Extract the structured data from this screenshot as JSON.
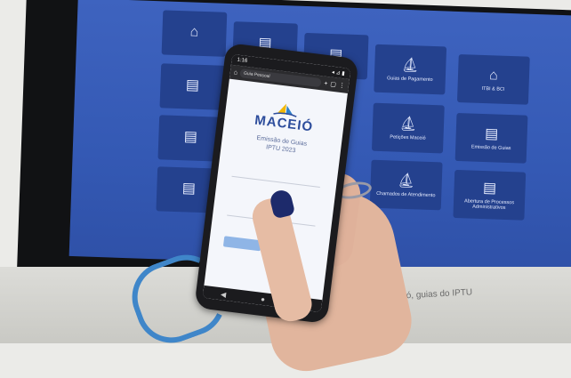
{
  "scene": {
    "description_colors": {
      "screen": "#3a5fbd",
      "tile": "#24418e",
      "phone": "#1b1b1e",
      "cable": "#3f86c9"
    }
  },
  "monitor": {
    "tiles": [
      {
        "label": "",
        "icon": "house-icon"
      },
      {
        "label": "",
        "icon": "document-icon"
      },
      {
        "label": "",
        "icon": "document-icon"
      },
      {
        "label": "Guias de Pagamento",
        "icon": "sail-icon"
      },
      {
        "label": "ITBI & BCI",
        "icon": "building-icon"
      },
      {
        "label": "",
        "icon": "document-icon"
      },
      {
        "label": "",
        "icon": "document-icon"
      },
      {
        "label": "Petições Maceió",
        "icon": "sail-icon"
      },
      {
        "label": "Emissão de Guias",
        "icon": "document-icon"
      },
      {
        "label": "",
        "icon": "document-icon"
      },
      {
        "label": "Chamados de Atendimento",
        "icon": "sail-icon"
      },
      {
        "label": "Abertura de Processos Administrativos",
        "icon": "document-icon"
      },
      {
        "label": "",
        "icon": "document-icon"
      }
    ],
    "bottom_text": "Maceió, guias do IPTU"
  },
  "phone": {
    "status_time": "1:16",
    "status_icons": "◂ ⊿ ▮",
    "url": "Guia Pessoal",
    "logo_text": "MACEIÓ",
    "subtitle_line1": "Emissão de Guias",
    "subtitle_line2": "IPTU 2023",
    "field1_label": "",
    "field2_label": "",
    "button_label": "",
    "nav": {
      "back": "◀",
      "home": "●",
      "recent": "■"
    }
  }
}
